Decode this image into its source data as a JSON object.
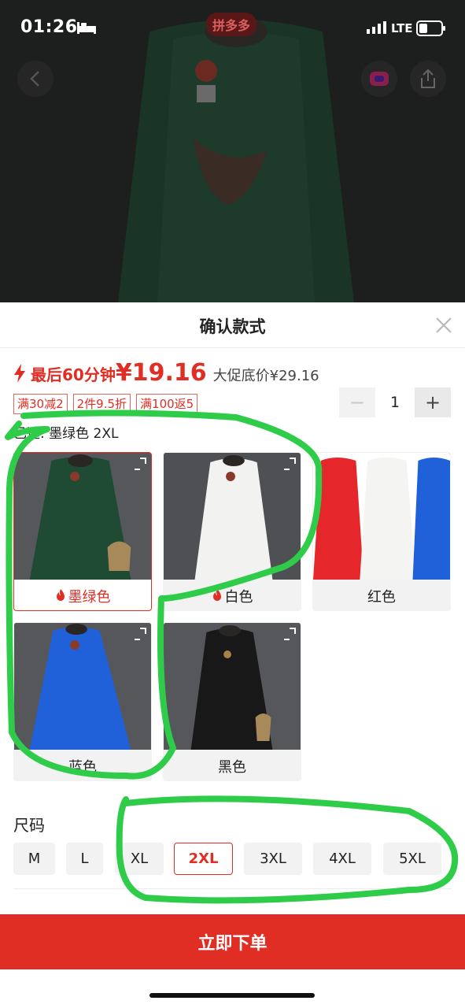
{
  "status_bar": {
    "time": "01:26",
    "network": "LTE"
  },
  "hero": {
    "brand_badge": "拼多多"
  },
  "sheet": {
    "title": "确认款式",
    "price": {
      "prefix": "最后60分钟",
      "current": "¥19.16",
      "original": "大促底价¥29.16"
    },
    "tags": [
      "满30减2",
      "2件9.5折",
      "满100返5"
    ],
    "quantity": 1,
    "selected_text": "已选: 墨绿色 2XL",
    "colors": [
      {
        "label": "墨绿色",
        "hot": true,
        "selected": true,
        "swatch": "#1f4a34"
      },
      {
        "label": "白色",
        "hot": true,
        "selected": false,
        "swatch": "#f2f2f0"
      },
      {
        "label": "红色",
        "hot": false,
        "selected": false,
        "swatch": "#e5262a"
      },
      {
        "label": "蓝色",
        "hot": false,
        "selected": false,
        "swatch": "#2060d8"
      },
      {
        "label": "黑色",
        "hot": false,
        "selected": false,
        "swatch": "#181818"
      }
    ],
    "size_title": "尺码",
    "sizes": [
      "M",
      "L",
      "XL",
      "2XL",
      "3XL",
      "4XL",
      "5XL"
    ],
    "selected_size": "2XL",
    "order_button": "立即下单"
  },
  "colors": {
    "accent": "#e02e24",
    "annotation": "#2fcc4a"
  }
}
